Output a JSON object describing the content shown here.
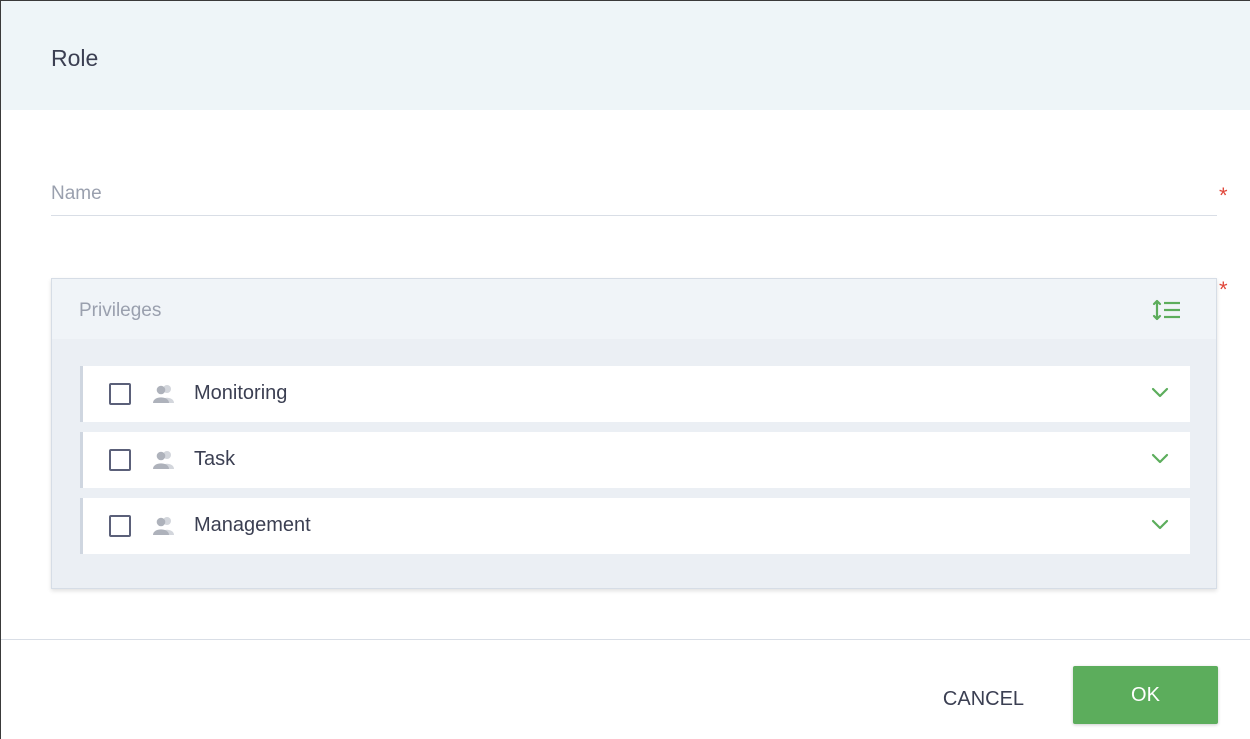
{
  "dialog": {
    "title": "Role"
  },
  "name_field": {
    "placeholder": "Name",
    "value": "",
    "required_marker": "*"
  },
  "privileges": {
    "title": "Privileges",
    "required_marker": "*",
    "sort_icon": "sort-list-icon",
    "items": [
      {
        "label": "Monitoring",
        "checked": false,
        "icon": "users-group-icon",
        "expand_icon": "chevron-down-icon"
      },
      {
        "label": "Task",
        "checked": false,
        "icon": "users-group-icon",
        "expand_icon": "chevron-down-icon"
      },
      {
        "label": "Management",
        "checked": false,
        "icon": "users-group-icon",
        "expand_icon": "chevron-down-icon"
      }
    ]
  },
  "footer": {
    "cancel_label": "CANCEL",
    "ok_label": "OK"
  },
  "colors": {
    "accent_green": "#5cad5c",
    "required_red": "#e0473a",
    "header_bg": "#eef5f8",
    "text_dark": "#3b3f52",
    "text_muted": "#9aa0ae"
  }
}
